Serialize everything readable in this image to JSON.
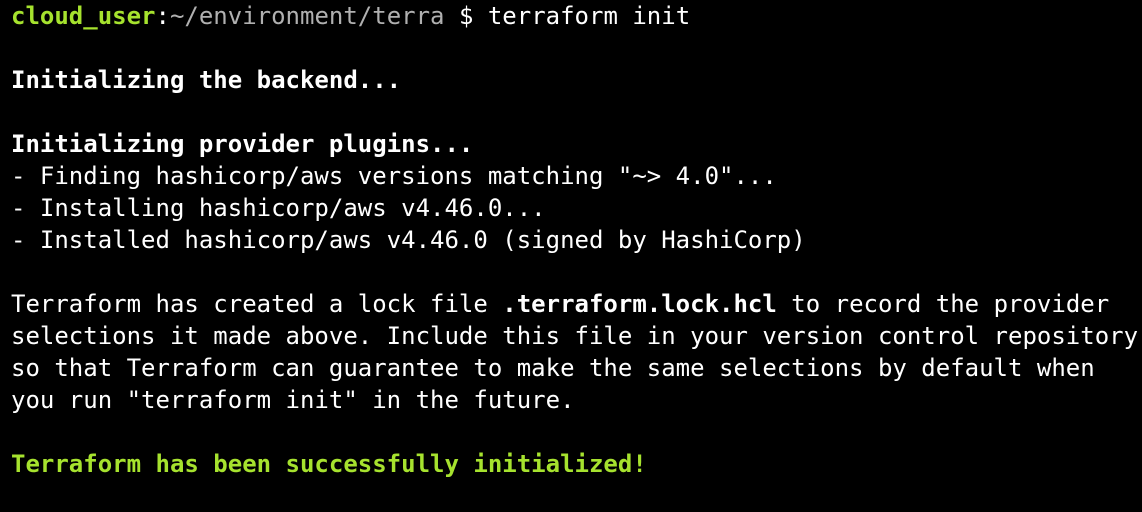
{
  "colors": {
    "background": "#000000",
    "text": "#ffffff",
    "prompt_user": "#a6e22e",
    "prompt_path": "#b0b0b0",
    "success": "#a6e22e"
  },
  "prompt": {
    "user": "cloud_user",
    "separator": ":",
    "path": "~/environment/terra",
    "symbol": " $ ",
    "command": "terraform init"
  },
  "output": {
    "backend": "Initializing the backend...",
    "plugins_heading": "Initializing provider plugins...",
    "plugin_lines": [
      "- Finding hashicorp/aws versions matching \"~> 4.0\"...",
      "- Installing hashicorp/aws v4.46.0...",
      "- Installed hashicorp/aws v4.46.0 (signed by HashiCorp)"
    ],
    "lock_line1_pre": "Terraform has created a lock file ",
    "lock_file": ".terraform.lock.hcl",
    "lock_line1_post": " to record the provider",
    "lock_line2": "selections it made above. Include this file in your version control repository",
    "lock_line3": "so that Terraform can guarantee to make the same selections by default when",
    "lock_line4": "you run \"terraform init\" in the future.",
    "success": "Terraform has been successfully initialized!"
  }
}
